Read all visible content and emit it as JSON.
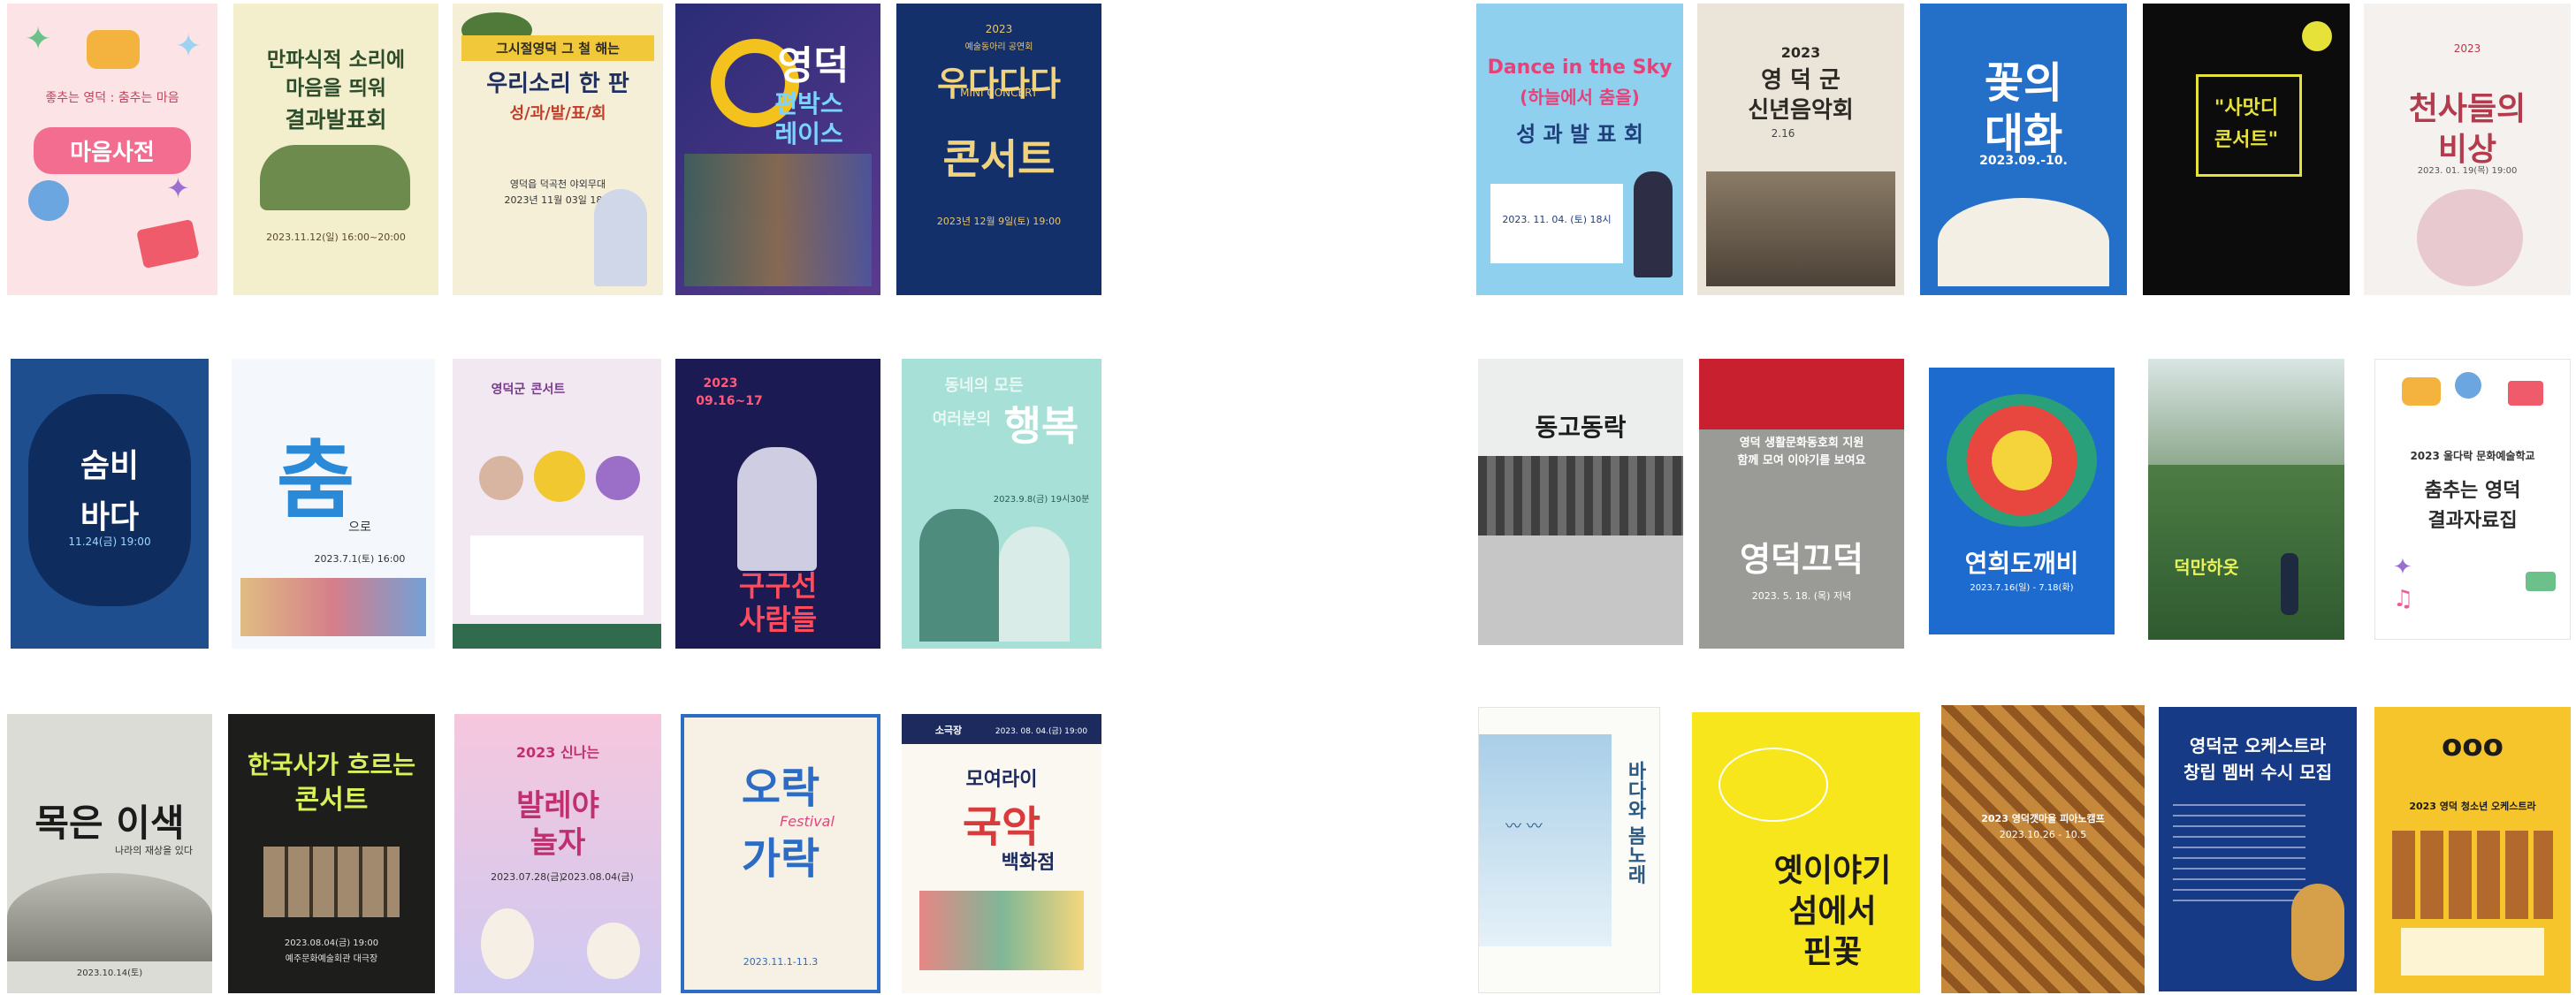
{
  "posters": [
    {
      "id": "p1",
      "lines": [
        "좋추는 영덕 : 춤추는 마음",
        "마음사전"
      ]
    },
    {
      "id": "p2",
      "lines": [
        "만파식적 소리에",
        "마음을 띄워",
        "결과발표회",
        "2023.11.12(일) 16:00~20:00"
      ]
    },
    {
      "id": "p3",
      "lines": [
        "그시절영덕 그 철 해는",
        "우리소리 한 판",
        "성/과/발/표/회",
        "영덕읍 덕곡천 야외무대",
        "2023년 11월 03일 18시"
      ]
    },
    {
      "id": "p4",
      "lines": [
        "영덕",
        "편박스",
        "레이스"
      ]
    },
    {
      "id": "p5",
      "lines": [
        "2023",
        "예술동아리 공연회",
        "MINI CONCERT",
        "우다다다",
        "콘서트",
        "2023년 12월 9일(토) 19:00"
      ]
    },
    {
      "id": "p6",
      "lines": [
        "Dance in the Sky",
        "(하늘에서 춤을)",
        "성 과 발 표 회",
        "2023. 11. 04. (토) 18시"
      ]
    },
    {
      "id": "p7",
      "lines": [
        "2023",
        "영 덕 군",
        "신년음악회",
        "2.16"
      ]
    },
    {
      "id": "p8",
      "lines": [
        "꽃의",
        "대화",
        "2023.09.-10."
      ]
    },
    {
      "id": "p9",
      "lines": [
        "\"사맛디",
        "콘서트\""
      ]
    },
    {
      "id": "p10",
      "lines": [
        "2023",
        "천사들의",
        "비상",
        "2023. 01. 19(목) 19:00"
      ]
    },
    {
      "id": "p11",
      "lines": [
        "숨비",
        "바다",
        "11.24(금) 19:00"
      ]
    },
    {
      "id": "p12",
      "lines": [
        "춤",
        "으로",
        "2023.7.1(토) 16:00"
      ]
    },
    {
      "id": "p13",
      "lines": [
        "영덕군",
        "콘서트"
      ]
    },
    {
      "id": "p14",
      "lines": [
        "2023",
        "09.16~17",
        "구구선",
        "사람들"
      ]
    },
    {
      "id": "p15",
      "lines": [
        "동네의 모든",
        "행복",
        "여러분의",
        "2023.9.8(금) 19시30분"
      ]
    },
    {
      "id": "p16",
      "lines": [
        "동고동락"
      ]
    },
    {
      "id": "p17",
      "lines": [
        "영덕 생활문화동호회 지원",
        "함께 모여 이야기를 보여요",
        "영덕끄덕",
        "2023. 5. 18. (목) 저녁"
      ]
    },
    {
      "id": "p18",
      "lines": [
        "연희도깨비",
        "2023.7.16(일) - 7.18(화)"
      ]
    },
    {
      "id": "p19",
      "lines": [
        "덕만하옷"
      ]
    },
    {
      "id": "p20",
      "lines": [
        "2023 울다락 문화예술학교",
        "춤추는 영덕",
        "결과자료집"
      ]
    },
    {
      "id": "p21",
      "lines": [
        "목은 이색",
        "나라의 재상을 있다",
        "2023.10.14(토)"
      ]
    },
    {
      "id": "p22",
      "lines": [
        "한국사가 흐르는",
        "콘서트",
        "2023.08.04(금) 19:00",
        "예주문화예술회관 대극장"
      ]
    },
    {
      "id": "p23",
      "lines": [
        "2023 신나는",
        "발레야",
        "놀자",
        "2023.07.28(금)",
        "2023.08.04(금)"
      ]
    },
    {
      "id": "p24",
      "lines": [
        "오락",
        "가락",
        "Festival",
        "2023.11.1-11.3"
      ]
    },
    {
      "id": "p25",
      "lines": [
        "소극장",
        "모여라이",
        "국악",
        "백화점",
        "2023. 08. 04.(금) 19:00"
      ]
    },
    {
      "id": "p26",
      "lines": [
        "바다와 봄노래"
      ]
    },
    {
      "id": "p27",
      "lines": [
        "옛이야기",
        "섬에서",
        "핀꽃"
      ]
    },
    {
      "id": "p28",
      "lines": [
        "2023 영덕갯마을 피아노캠프",
        "2023.10.26 - 10.5"
      ]
    },
    {
      "id": "p29",
      "lines": [
        "영덕군 오케스트라",
        "창립 멤버 수시 모집"
      ]
    },
    {
      "id": "p30",
      "lines": [
        "ooo",
        "2023 영덕 청소년 오케스트라"
      ]
    }
  ]
}
